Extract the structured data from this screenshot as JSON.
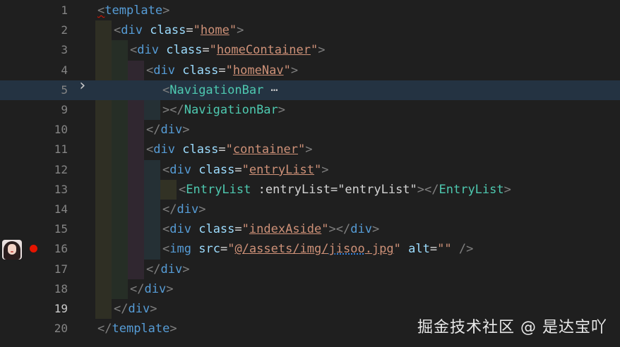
{
  "editor": {
    "theme_colors": {
      "background": "#1f1f1f",
      "tag": "#569cd6",
      "component": "#4ec9b0",
      "attribute": "#9cdcfe",
      "string": "#ce9178",
      "punctuation": "#808080",
      "breakpoint": "#e51400"
    },
    "lines": [
      {
        "num": "1",
        "tokens": [
          [
            "punc",
            "<"
          ],
          [
            "tag",
            "template"
          ],
          [
            "punc",
            ">"
          ]
        ]
      },
      {
        "num": "2",
        "tokens": [
          [
            "punc",
            "<"
          ],
          [
            "tag",
            "div"
          ],
          [
            "text",
            " "
          ],
          [
            "attr",
            "class"
          ],
          [
            "text",
            "="
          ],
          [
            "str",
            "\""
          ],
          [
            "strlink",
            "home"
          ],
          [
            "str",
            "\""
          ],
          [
            "punc",
            ">"
          ]
        ]
      },
      {
        "num": "3",
        "tokens": [
          [
            "punc",
            "<"
          ],
          [
            "tag",
            "div"
          ],
          [
            "text",
            " "
          ],
          [
            "attr",
            "class"
          ],
          [
            "text",
            "="
          ],
          [
            "str",
            "\""
          ],
          [
            "strlink",
            "homeContainer"
          ],
          [
            "str",
            "\""
          ],
          [
            "punc",
            ">"
          ]
        ]
      },
      {
        "num": "4",
        "tokens": [
          [
            "punc",
            "<"
          ],
          [
            "tag",
            "div"
          ],
          [
            "text",
            " "
          ],
          [
            "attr",
            "class"
          ],
          [
            "text",
            "="
          ],
          [
            "str",
            "\""
          ],
          [
            "strlink",
            "homeNav"
          ],
          [
            "str",
            "\""
          ],
          [
            "punc",
            ">"
          ]
        ]
      },
      {
        "num": "5",
        "tokens": [
          [
            "punc",
            "<"
          ],
          [
            "comp",
            "NavigationBar"
          ],
          [
            "ellipsis",
            " ⋯"
          ]
        ]
      },
      {
        "num": "9",
        "tokens": [
          [
            "punc",
            "></"
          ],
          [
            "comp",
            "NavigationBar"
          ],
          [
            "punc",
            ">"
          ]
        ]
      },
      {
        "num": "10",
        "tokens": [
          [
            "punc",
            "</"
          ],
          [
            "tag",
            "div"
          ],
          [
            "punc",
            ">"
          ]
        ]
      },
      {
        "num": "11",
        "tokens": [
          [
            "punc",
            "<"
          ],
          [
            "tag",
            "div"
          ],
          [
            "text",
            " "
          ],
          [
            "attr",
            "class"
          ],
          [
            "text",
            "="
          ],
          [
            "str",
            "\""
          ],
          [
            "strlink",
            "container"
          ],
          [
            "str",
            "\""
          ],
          [
            "punc",
            ">"
          ]
        ]
      },
      {
        "num": "12",
        "tokens": [
          [
            "punc",
            "<"
          ],
          [
            "tag",
            "div"
          ],
          [
            "text",
            " "
          ],
          [
            "attr",
            "class"
          ],
          [
            "text",
            "="
          ],
          [
            "str",
            "\""
          ],
          [
            "strlink",
            "entryList"
          ],
          [
            "str",
            "\""
          ],
          [
            "punc",
            ">"
          ]
        ]
      },
      {
        "num": "13",
        "tokens": [
          [
            "punc",
            "<"
          ],
          [
            "comp",
            "EntryList"
          ],
          [
            "text",
            " :entryList=\"entryList\""
          ],
          [
            "punc",
            "></"
          ],
          [
            "comp",
            "EntryList"
          ],
          [
            "punc",
            ">"
          ]
        ]
      },
      {
        "num": "14",
        "tokens": [
          [
            "punc",
            "</"
          ],
          [
            "tag",
            "div"
          ],
          [
            "punc",
            ">"
          ]
        ]
      },
      {
        "num": "15",
        "tokens": [
          [
            "punc",
            "<"
          ],
          [
            "tag",
            "div"
          ],
          [
            "text",
            " "
          ],
          [
            "attr",
            "class"
          ],
          [
            "text",
            "="
          ],
          [
            "str",
            "\""
          ],
          [
            "strlink",
            "indexAside"
          ],
          [
            "str",
            "\""
          ],
          [
            "punc",
            "></"
          ],
          [
            "tag",
            "div"
          ],
          [
            "punc",
            ">"
          ]
        ]
      },
      {
        "num": "16",
        "tokens": [
          [
            "punc",
            "<"
          ],
          [
            "tag",
            "img"
          ],
          [
            "text",
            " "
          ],
          [
            "attr",
            "src"
          ],
          [
            "text",
            "="
          ],
          [
            "str",
            "\""
          ],
          [
            "strlink",
            "@/assets/img/"
          ],
          [
            "strspell",
            "jisoo"
          ],
          [
            "strlink",
            ".jpg"
          ],
          [
            "str",
            "\""
          ],
          [
            "text",
            " "
          ],
          [
            "attr",
            "alt"
          ],
          [
            "text",
            "="
          ],
          [
            "str",
            "\"\""
          ],
          [
            "text",
            " "
          ],
          [
            "punc",
            "/>"
          ]
        ]
      },
      {
        "num": "17",
        "tokens": [
          [
            "punc",
            "</"
          ],
          [
            "tag",
            "div"
          ],
          [
            "punc",
            ">"
          ]
        ]
      },
      {
        "num": "18",
        "tokens": [
          [
            "punc",
            "</"
          ],
          [
            "tag",
            "div"
          ],
          [
            "punc",
            ">"
          ]
        ]
      },
      {
        "num": "19",
        "tokens": [
          [
            "punc",
            "</"
          ],
          [
            "tag",
            "div"
          ],
          [
            "punc",
            ">"
          ]
        ]
      },
      {
        "num": "20",
        "tokens": [
          [
            "punc",
            "</"
          ],
          [
            "tag",
            "template"
          ],
          [
            "punc",
            ">"
          ]
        ]
      }
    ],
    "current_line": "19",
    "folded_line": "5",
    "breakpoint_line": "16"
  },
  "watermark": "掘金技术社区 @ 是达宝吖"
}
